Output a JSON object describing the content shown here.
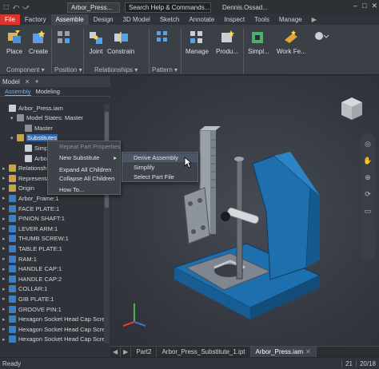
{
  "titlebar": {
    "qat": [
      "⬚",
      "⤺",
      "⤻"
    ],
    "doc_title": "Arbor_Press...",
    "search": "Search Help & Commands...",
    "user": "Dennis.Ossad...",
    "win_controls": [
      "–",
      "□",
      "✕"
    ]
  },
  "menu": {
    "tabs": [
      "File",
      "Factory",
      "Assemble",
      "Design",
      "3D Model",
      "Sketch",
      "Annotate",
      "Inspect",
      "Tools",
      "Manage"
    ],
    "active": "Assemble",
    "play": "▶"
  },
  "ribbon": {
    "buttons": [
      {
        "label": "Place",
        "icon": "place-component-icon"
      },
      {
        "label": "Create",
        "icon": "create-component-icon"
      },
      {
        "label": "",
        "icon": "position-icon"
      },
      {
        "label": "Joint",
        "icon": "joint-icon"
      },
      {
        "label": "Constrain",
        "icon": "constrain-icon"
      },
      {
        "label": "",
        "icon": "pattern-icon"
      },
      {
        "label": "Manage",
        "icon": "manage-icon"
      },
      {
        "label": "Produ...",
        "icon": "productivity-icon"
      },
      {
        "label": "Simpl...",
        "icon": "simplify-icon"
      },
      {
        "label": "Work Fe...",
        "icon": "work-features-icon"
      }
    ],
    "panels": [
      "Component ▾",
      "Position ▾",
      "Relationships ▾",
      "Pattern ▾"
    ]
  },
  "browser": {
    "tab": "Model",
    "subtabs": [
      "Assembly",
      "Modeling"
    ],
    "items": [
      {
        "label": "Arbor_Press.iam",
        "icon": "asm",
        "level": 0,
        "exp": ""
      },
      {
        "label": "Model States: Master",
        "icon": "state",
        "level": 1,
        "exp": "▾"
      },
      {
        "label": "Master",
        "icon": "state",
        "level": 2,
        "exp": ""
      },
      {
        "label": "Substitutes",
        "icon": "folder",
        "level": 1,
        "exp": "▾",
        "selected": true
      },
      {
        "label": "Simp",
        "icon": "asm",
        "level": 2,
        "exp": ""
      },
      {
        "label": "Arbo",
        "icon": "asm",
        "level": 2,
        "exp": ""
      },
      {
        "label": "Relationships",
        "icon": "folder",
        "level": 0,
        "exp": "▸"
      },
      {
        "label": "Representations",
        "icon": "folder",
        "level": 0,
        "exp": "▸"
      },
      {
        "label": "Origin",
        "icon": "folder",
        "level": 0,
        "exp": "▸"
      },
      {
        "label": "Arbor_Frame:1",
        "icon": "part",
        "level": 0,
        "exp": "▸"
      },
      {
        "label": "FACE PLATE:1",
        "icon": "part",
        "level": 0,
        "exp": "▸"
      },
      {
        "label": "PINION SHAFT:1",
        "icon": "part",
        "level": 0,
        "exp": "▸"
      },
      {
        "label": "LEVER ARM:1",
        "icon": "part",
        "level": 0,
        "exp": "▸"
      },
      {
        "label": "THUMB SCREW:1",
        "icon": "part",
        "level": 0,
        "exp": "▸"
      },
      {
        "label": "TABLE PLATE:1",
        "icon": "part",
        "level": 0,
        "exp": "▸"
      },
      {
        "label": "RAM:1",
        "icon": "part",
        "level": 0,
        "exp": "▸"
      },
      {
        "label": "HANDLE CAP:1",
        "icon": "part",
        "level": 0,
        "exp": "▸"
      },
      {
        "label": "HANDLE CAP:2",
        "icon": "part",
        "level": 0,
        "exp": "▸"
      },
      {
        "label": "COLLAR:1",
        "icon": "part",
        "level": 0,
        "exp": "▸"
      },
      {
        "label": "GIB PLATE:1",
        "icon": "part",
        "level": 0,
        "exp": "▸"
      },
      {
        "label": "GROOVE PIN:1",
        "icon": "part",
        "level": 0,
        "exp": "▸"
      },
      {
        "label": "Hexagon Socket Head Cap Screw",
        "icon": "part",
        "level": 0,
        "exp": "▸"
      },
      {
        "label": "Hexagon Socket Head Cap Screw",
        "icon": "part",
        "level": 0,
        "exp": "▸"
      },
      {
        "label": "Hexagon Socket Head Cap Screw",
        "icon": "part",
        "level": 0,
        "exp": "▸"
      }
    ]
  },
  "context_menu": {
    "items": [
      {
        "label": "Repeat Part Properties",
        "disabled": true
      },
      {
        "label": "New Substitute",
        "submenu": true
      },
      {
        "label": "Expand All Children"
      },
      {
        "label": "Collapse All Children"
      },
      {
        "label": "How To..."
      }
    ],
    "submenu": [
      {
        "label": "Derive Assembly",
        "hot": true
      },
      {
        "label": "Simplify"
      },
      {
        "label": "Select Part File"
      }
    ]
  },
  "document_tabs": {
    "nav": [
      "◀",
      "▶"
    ],
    "tabs": [
      {
        "label": "Part2",
        "active": false
      },
      {
        "label": "Arbor_Press_Substitute_1.ipt",
        "active": false
      },
      {
        "label": "Arbor_Press.iam",
        "active": true
      }
    ]
  },
  "status": {
    "left": "Ready",
    "counts": [
      "21",
      "20/18"
    ]
  },
  "colors": {
    "accent": "#2f6bb3",
    "file_tab": "#d9352b",
    "model_blue": "#1d6fae"
  }
}
